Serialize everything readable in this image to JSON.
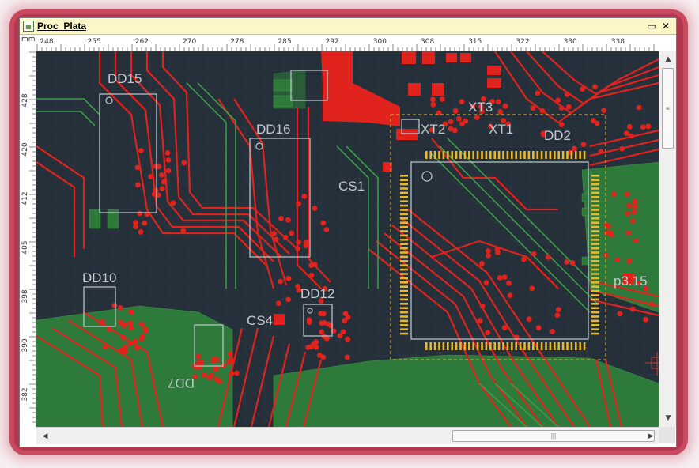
{
  "window": {
    "title": "Proc_Plata",
    "app_icon": "document-icon",
    "restore_glyph": "▭",
    "close_glyph": "✕"
  },
  "ruler": {
    "unit": "mm",
    "top_ticks": [
      "248",
      "255",
      "262",
      "270",
      "278",
      "285",
      "292",
      "300",
      "308",
      "315",
      "322",
      "330",
      "338"
    ],
    "left_ticks": [
      "428",
      "420",
      "412",
      "405",
      "398",
      "390",
      "382"
    ]
  },
  "designators": {
    "dd15": "DD15",
    "dd16": "DD16",
    "dd2": "DD2",
    "dd10": "DD10",
    "dd12": "DD12",
    "dd7": "DD7",
    "cs1": "CS1",
    "cs4": "CS4",
    "xt3": "XT3",
    "xt2": "XT2",
    "xt1": "XT1",
    "p3_15": "p3.15"
  },
  "colors": {
    "board_bg": "#25303a",
    "copper_top": "#e0231c",
    "copper_bottom": "#2e7a3a",
    "silkscreen": "#c4c9cf",
    "pad_gold": "#e8b830",
    "frame": "#c9495f"
  },
  "scrollbars": {
    "up": "▲",
    "down": "▼",
    "left": "◀",
    "right": "▶",
    "grip": "≡",
    "hgrip": "|||"
  }
}
